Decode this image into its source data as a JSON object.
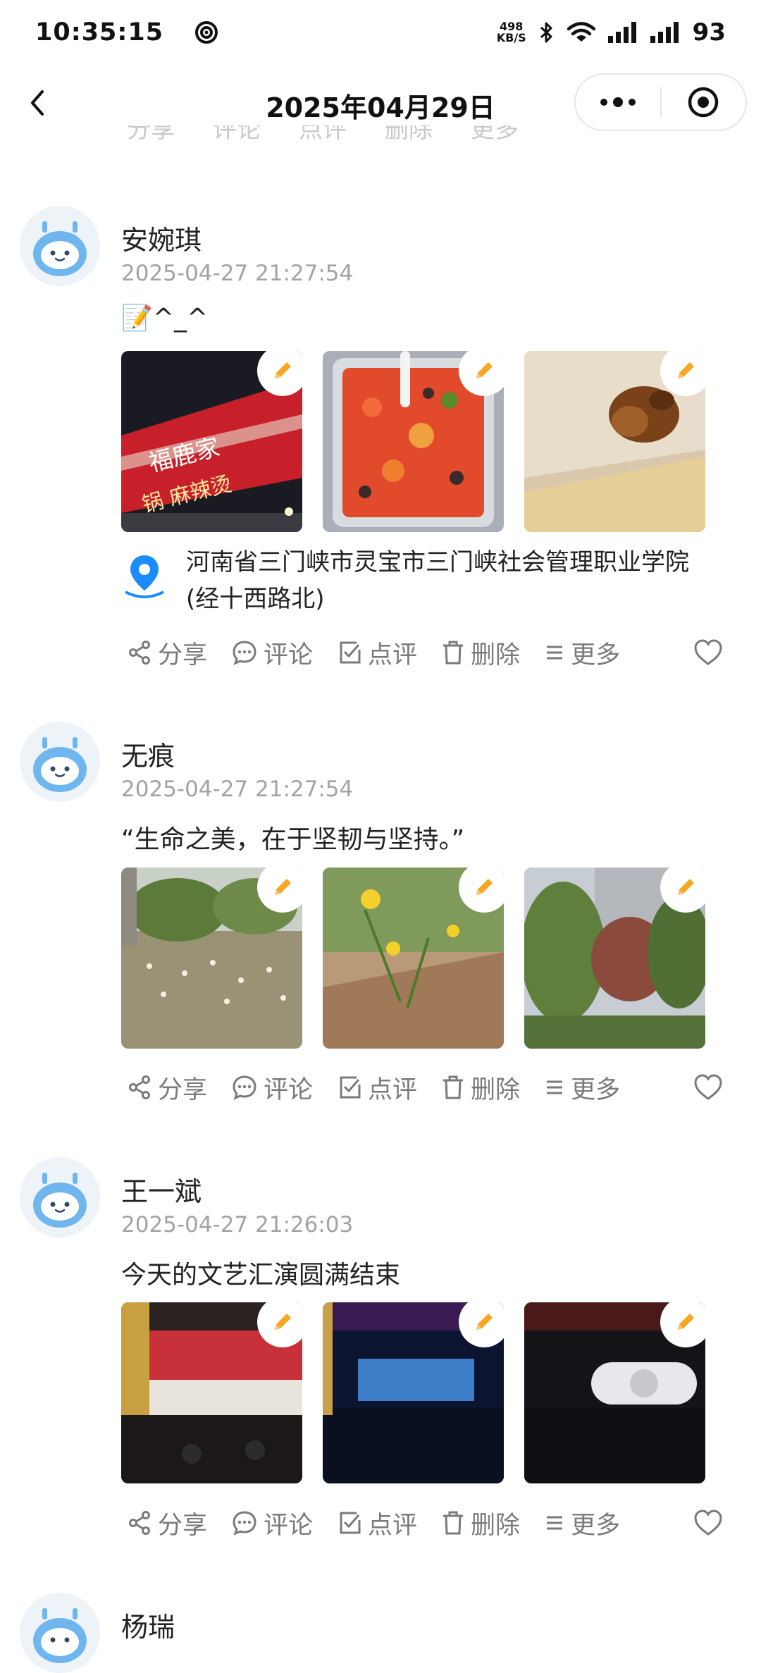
{
  "status_bar": {
    "time": "10:35:15",
    "net_speed_value": "498",
    "net_speed_unit": "KB/S",
    "battery": "93"
  },
  "nav": {
    "title": "2025年04月29日"
  },
  "actions_labels": {
    "share": "分享",
    "comment": "评论",
    "review": "点评",
    "delete": "删除",
    "more": "更多"
  },
  "posts": [
    {
      "author": "安婉琪",
      "time": "2025-04-27 21:27:54",
      "text": "📝^_^",
      "location_line1": "河南省三门峡市灵宝市三门峡社会管理职业学院",
      "location_line2": "(经十西路北)",
      "photos": [
        "storefront sign photo",
        "tomato egg dish photo",
        "fried food photo"
      ]
    },
    {
      "author": "无痕",
      "time": "2025-04-27 21:27:54",
      "text": "“生命之美，在于坚韧与坚持。”",
      "photos": [
        "wildflower field photo",
        "yellow flower photo",
        "trees photo"
      ]
    },
    {
      "author": "王一斌",
      "time": "2025-04-27 21:26:03",
      "text": "今天的文艺汇演圆满结束",
      "photos": [
        "stage group photo",
        "auditorium photo",
        "stage performance photo"
      ]
    },
    {
      "author": "杨瑞"
    }
  ],
  "colors": {
    "accent_orange": "#f5a623",
    "location_blue": "#1a8cff",
    "meta_gray": "#a3a3a3",
    "action_gray": "#7a7a7a"
  },
  "icons": {
    "back": "chevron-left-icon",
    "more": "more-dots-icon",
    "close": "target-icon",
    "share": "share-icon",
    "comment": "comment-bubble-icon",
    "review": "checkbox-icon",
    "delete": "trash-icon",
    "more_menu": "list-icon",
    "like": "heart-icon",
    "edit": "pencil-icon",
    "location": "location-pin-icon"
  }
}
